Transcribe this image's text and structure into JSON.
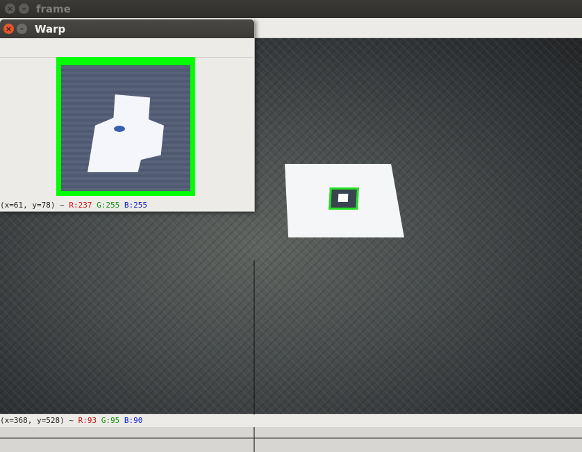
{
  "main_window": {
    "title": "frame",
    "close_glyph": "×",
    "minimize_glyph": "–",
    "status": {
      "coords": "(x=368, y=528) ~",
      "r": "R:93",
      "g": "G:95",
      "b": "B:90"
    }
  },
  "warp_window": {
    "title": "Warp",
    "close_glyph": "×",
    "minimize_glyph": "–",
    "status": {
      "coords": "(x=61, y=78) ~",
      "r": "R:237",
      "g": "G:255",
      "b": "B:255"
    }
  },
  "colors": {
    "marker_border": "#00ff00",
    "close_button": "#e0572f",
    "titlebar": "#3a3935"
  },
  "icons": [
    "close-icon",
    "minimize-icon"
  ]
}
